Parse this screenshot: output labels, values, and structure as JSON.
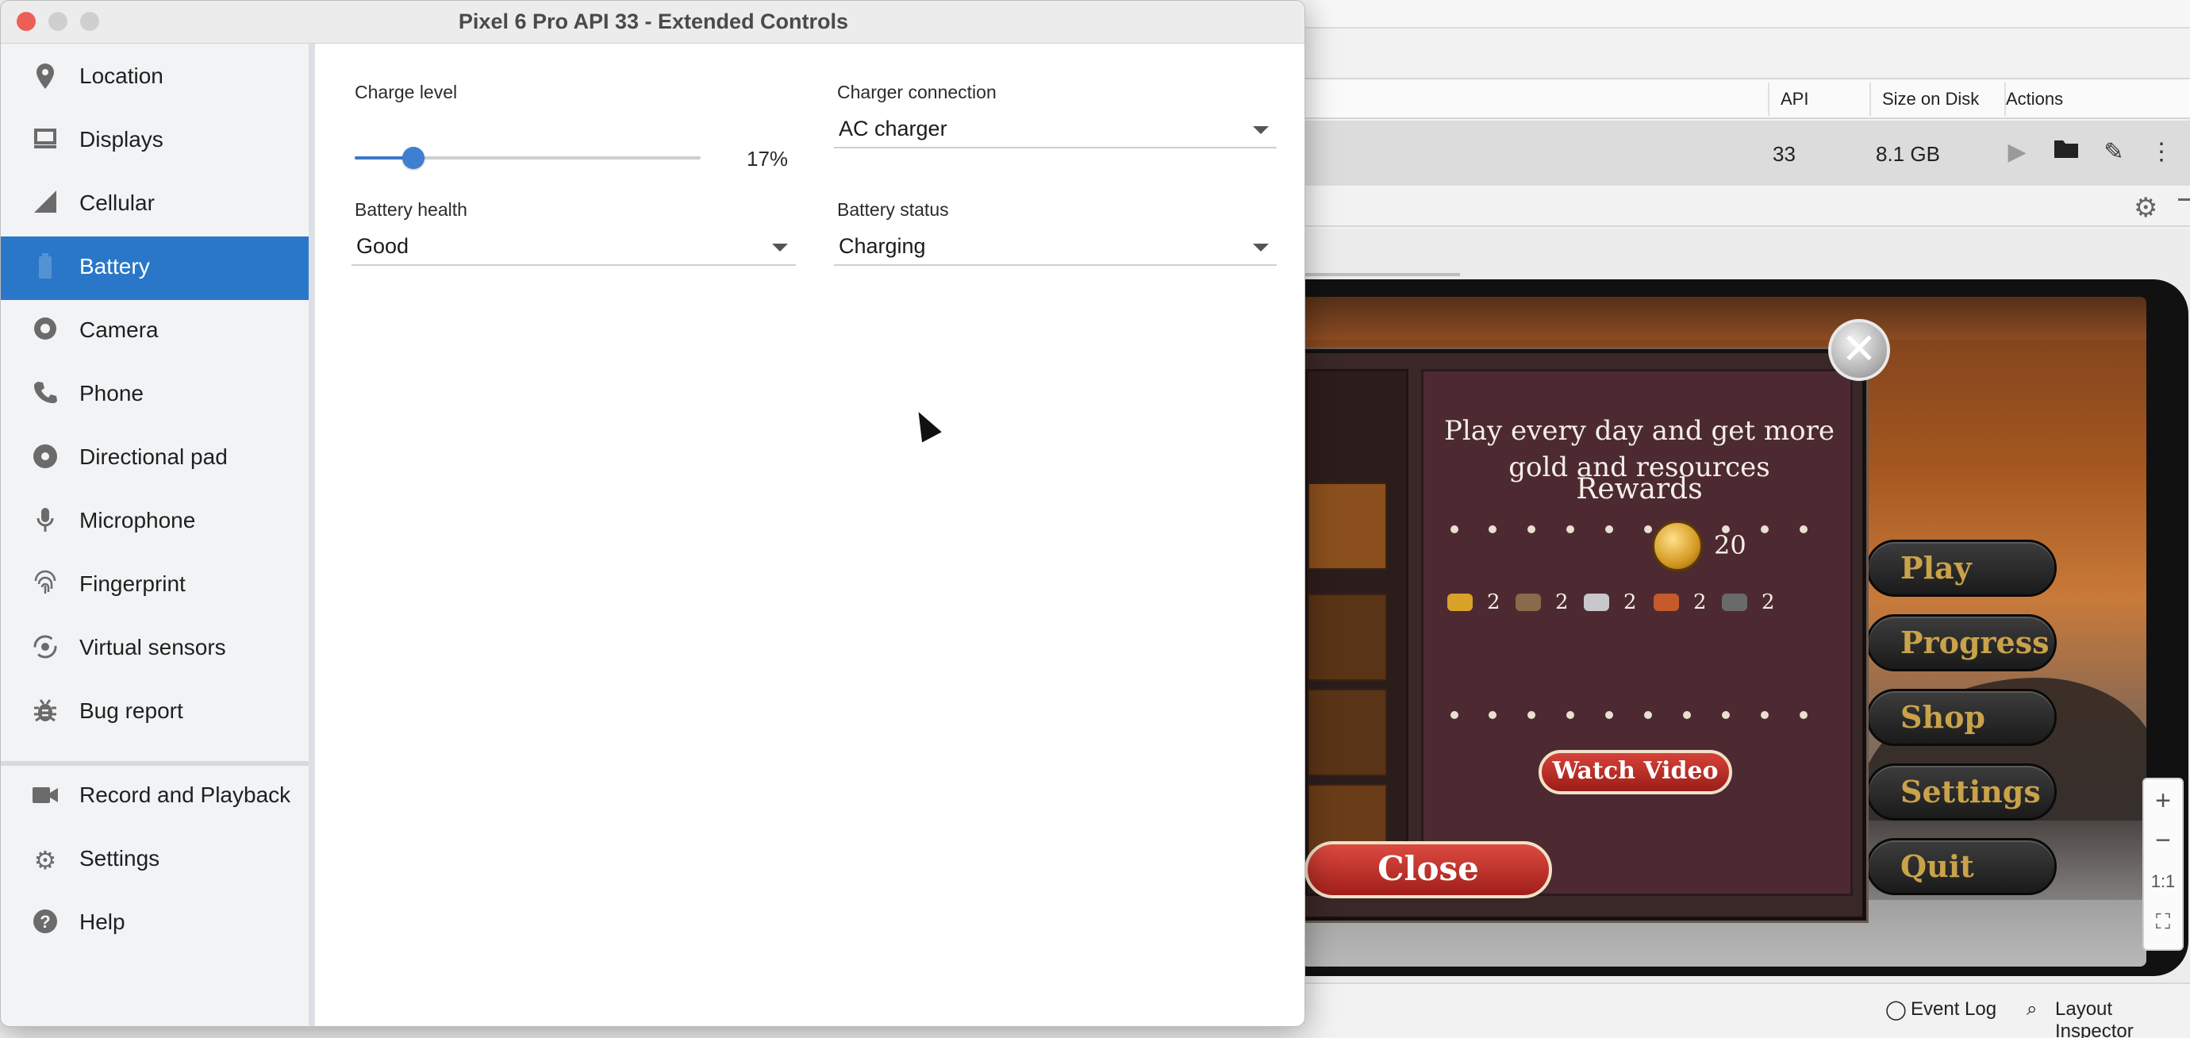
{
  "window": {
    "title": "Pixel 6 Pro API 33 - Extended Controls"
  },
  "sidebar": {
    "items": [
      {
        "label": "Location",
        "icon": "location-pin-icon"
      },
      {
        "label": "Displays",
        "icon": "display-icon"
      },
      {
        "label": "Cellular",
        "icon": "signal-icon"
      },
      {
        "label": "Battery",
        "icon": "battery-icon",
        "active": true
      },
      {
        "label": "Camera",
        "icon": "camera-icon"
      },
      {
        "label": "Phone",
        "icon": "phone-icon"
      },
      {
        "label": "Directional pad",
        "icon": "dpad-icon"
      },
      {
        "label": "Microphone",
        "icon": "microphone-icon"
      },
      {
        "label": "Fingerprint",
        "icon": "fingerprint-icon"
      },
      {
        "label": "Virtual sensors",
        "icon": "rotate-icon"
      },
      {
        "label": "Bug report",
        "icon": "bug-icon"
      },
      {
        "label": "Record and Playback",
        "icon": "videocam-icon"
      },
      {
        "label": "Settings",
        "icon": "gear-icon"
      },
      {
        "label": "Help",
        "icon": "help-icon"
      }
    ]
  },
  "battery": {
    "charge_level_label": "Charge level",
    "charge_level_value": 17,
    "charge_level_text": "17%",
    "charger_connection_label": "Charger connection",
    "charger_connection_value": "AC charger",
    "battery_health_label": "Battery health",
    "battery_health_value": "Good",
    "battery_status_label": "Battery status",
    "battery_status_value": "Charging",
    "accent_color": "#2a77c9"
  },
  "device_manager": {
    "columns": [
      "API",
      "Size on Disk",
      "Actions"
    ],
    "row": {
      "api": "33",
      "size": "8.1 GB"
    },
    "actions": [
      "play-icon",
      "folder-icon",
      "edit-icon",
      "more-vert-icon"
    ]
  },
  "statusbar": {
    "event_log": "Event Log",
    "layout_inspector": "Layout Inspector"
  },
  "zoom": {
    "plus": "+",
    "minus": "−",
    "one_to_one": "1:1"
  },
  "game": {
    "dialog_title": "Play every day and get more gold and resources",
    "rewards_label": "Rewards",
    "gold_amount": "20",
    "resources": [
      {
        "icon": "gold-bars-icon",
        "amount": "2",
        "color": "#d8a228"
      },
      {
        "icon": "wood-logs-icon",
        "amount": "2",
        "color": "#8a6a4a"
      },
      {
        "icon": "stone-icon",
        "amount": "2",
        "color": "#c8c8cc"
      },
      {
        "icon": "clay-bricks-icon",
        "amount": "2",
        "color": "#c65a2a"
      },
      {
        "icon": "iron-ore-icon",
        "amount": "2",
        "color": "#6a6a6a"
      }
    ],
    "watch_video": "Watch Video",
    "close": "Close",
    "menu": [
      "Play",
      "Progress",
      "Shop",
      "Settings",
      "Quit"
    ]
  }
}
